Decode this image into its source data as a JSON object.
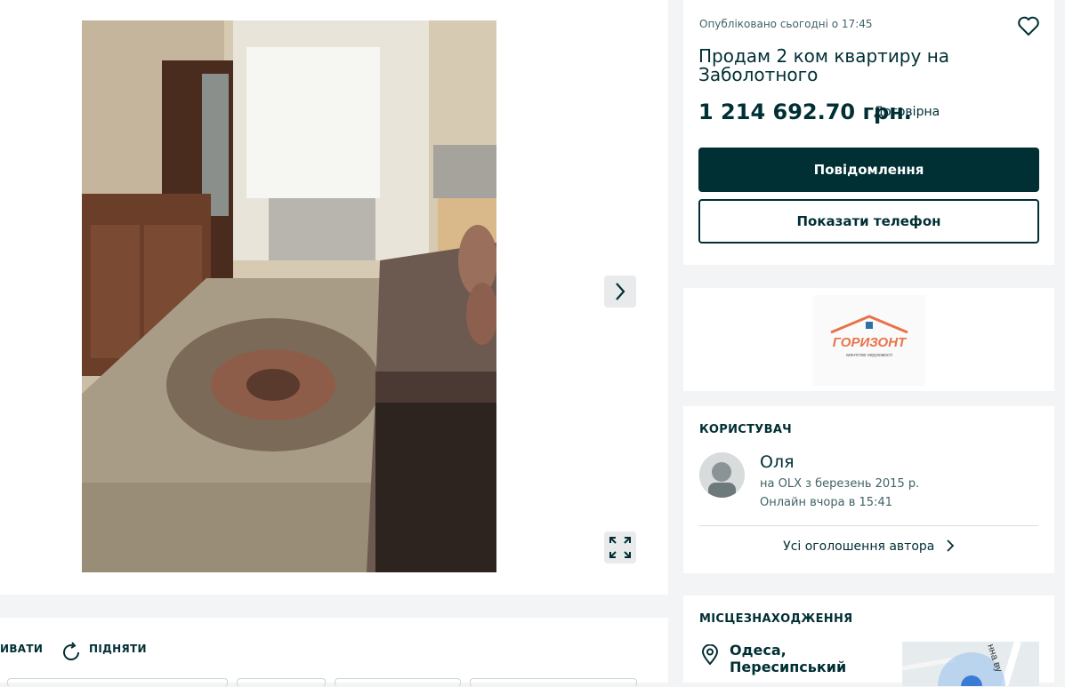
{
  "gallery": {
    "next_icon": "chevron-right-icon",
    "fullscreen_icon": "expand-icon"
  },
  "actions": {
    "edit_label": "ИВАТИ",
    "raise_label": "ПІДНЯТИ",
    "raise_icon": "refresh-icon"
  },
  "listing": {
    "posted": "Опубліковано сьогодні о 17:45",
    "title": "Продам 2 ком квартиру на Заболотного",
    "price": "1 214 692.70 грн.",
    "negotiable": "Договірна",
    "message_button": "Повідомлення",
    "phone_button": "Показати телефон",
    "favorite_icon": "heart-icon"
  },
  "agency": {
    "logo_name": "ГОРИЗОНТ",
    "logo_tagline": "агентство нерухомості",
    "accent": "#e8734a"
  },
  "user": {
    "heading": "КОРИСТУВАЧ",
    "name": "Оля",
    "since": "на OLX з березень 2015 р.",
    "online": "Онлайн вчора в 15:41",
    "all_ads": "Усі оголошення автора"
  },
  "location": {
    "heading": "МІСЦЕЗНАХОДЖЕННЯ",
    "city": "Одеса,",
    "district": "Пересипський",
    "map_street": "нна ву"
  },
  "colors": {
    "primary": "#002f34",
    "muted": "#406367",
    "background": "#f2f4f5"
  }
}
